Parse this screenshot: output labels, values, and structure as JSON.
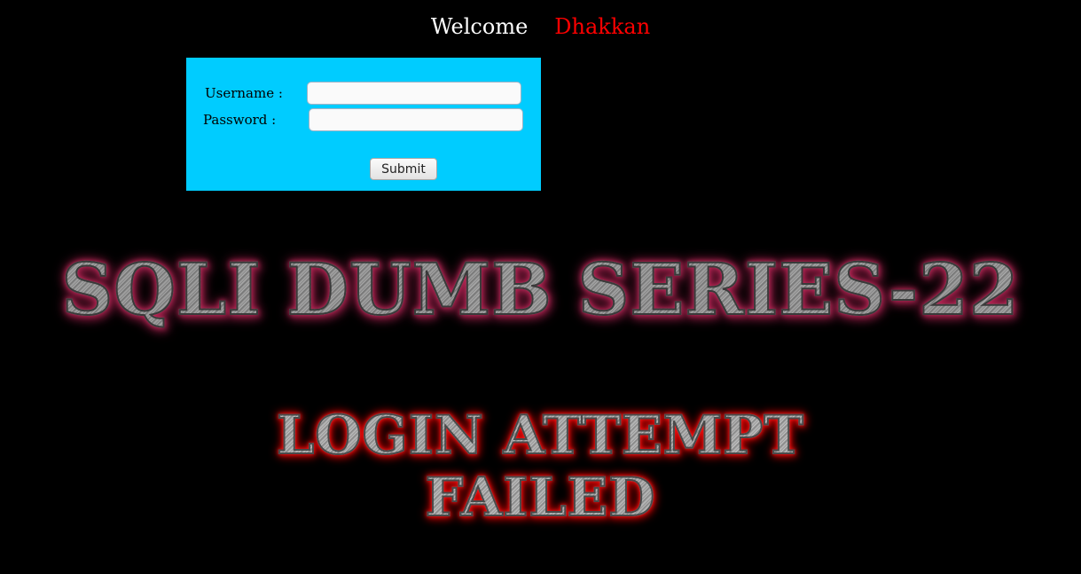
{
  "header": {
    "welcome_text": "Welcome",
    "user_name": "Dhakkan"
  },
  "login_form": {
    "username_label": "Username :",
    "username_value": "",
    "password_label": "Password :",
    "password_value": "",
    "submit_label": "Submit"
  },
  "banners": {
    "title": "SQLI DUMB SERIES-22",
    "status_line1": "LOGIN ATTEMPT",
    "status_line2": "FAILED"
  },
  "colors": {
    "page_background": "#000000",
    "form_background": "#00ccff",
    "welcome_text": "#ffffff",
    "user_name": "#ff0000",
    "title_glow": "#c22a5a",
    "status_glow": "#ff0000"
  }
}
